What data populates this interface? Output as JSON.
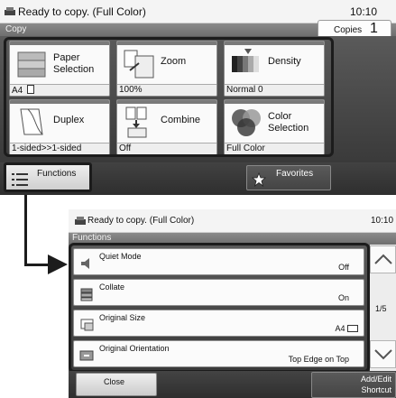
{
  "status": {
    "message": "Ready to copy. (Full Color)",
    "time": "10:10"
  },
  "screen_title": "Copy",
  "copies": {
    "label": "Copies",
    "value": "1"
  },
  "functions_grid": [
    {
      "label_line1": "Paper",
      "label_line2": "Selection",
      "value": "A4",
      "icon": "paper-tray-icon"
    },
    {
      "label_line1": "Zoom",
      "label_line2": "",
      "value": "100%",
      "icon": "zoom-icon"
    },
    {
      "label_line1": "Density",
      "label_line2": "",
      "value": "Normal 0",
      "icon": "density-icon"
    },
    {
      "label_line1": "Duplex",
      "label_line2": "",
      "value": "1-sided>>1-sided",
      "icon": "duplex-icon"
    },
    {
      "label_line1": "Combine",
      "label_line2": "",
      "value": "Off",
      "icon": "combine-icon"
    },
    {
      "label_line1": "Color",
      "label_line2": "Selection",
      "value": "Full Color",
      "icon": "color-selection-icon"
    }
  ],
  "bottom_bar": {
    "functions_label": "Functions",
    "favorites_label": "Favorites"
  },
  "functions_screen": {
    "status_message": "Ready to copy. (Full Color)",
    "time": "10:10",
    "title": "Functions",
    "rows": [
      {
        "label": "Quiet Mode",
        "value": "Off",
        "icon": "speaker-icon"
      },
      {
        "label": "Collate",
        "value": "On",
        "icon": "collate-icon"
      },
      {
        "label": "Original Size",
        "value": "A4",
        "icon": "original-size-icon"
      },
      {
        "label": "Original Orientation",
        "value": "Top Edge on Top",
        "icon": "orientation-icon"
      }
    ],
    "page_indicator": "1/5",
    "close_label": "Close",
    "add_edit_line1": "Add/Edit",
    "add_edit_line2": "Shortcut"
  },
  "colors": {
    "dark_panel": "#3a3a3a",
    "highlight_frame": "#1c1c1c",
    "title_bar": "#7a7a7a"
  }
}
